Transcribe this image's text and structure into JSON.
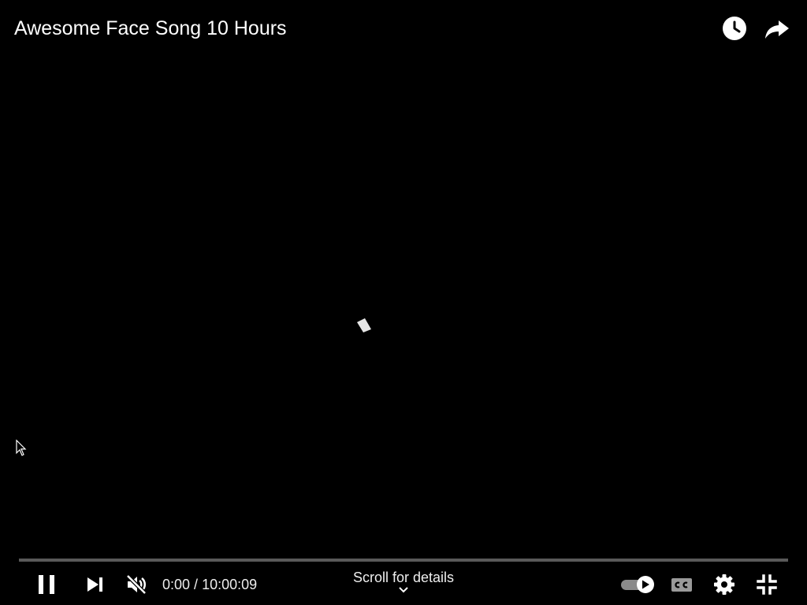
{
  "video": {
    "title": "Awesome Face Song 10 Hours"
  },
  "controls": {
    "current_time": "0:00",
    "separator": " / ",
    "duration": "10:00:09",
    "scroll_label": "Scroll for details",
    "progress_fraction": 0,
    "state": "playing",
    "muted": true,
    "autoplay_on": true
  },
  "icons": {
    "watch_later": "clock-icon",
    "share": "share-arrow-icon",
    "pause": "pause-icon",
    "next": "skip-next-icon",
    "mute": "volume-muted-icon",
    "scroll": "chevron-down-icon",
    "autoplay": "autoplay-toggle-icon",
    "cc": "closed-captions-icon",
    "settings": "gear-icon",
    "exit_fullscreen": "exit-fullscreen-icon",
    "loading": "loading-spinner-icon",
    "cursor": "mouse-cursor-icon"
  },
  "colors": {
    "background": "#000000",
    "icon": "#ffffff",
    "text": "#eeeeee",
    "progress_played": "#ff0000",
    "progress_track": "#595959"
  }
}
